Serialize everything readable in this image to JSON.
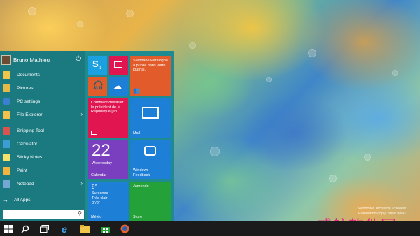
{
  "start_menu": {
    "user": {
      "name": "Bruno Mathieu"
    },
    "items": [
      {
        "label": "Documents",
        "icon": "folder-icon",
        "color": "#f0c64a"
      },
      {
        "label": "Pictures",
        "icon": "pictures-icon",
        "color": "#e7b949"
      },
      {
        "label": "PC settings",
        "icon": "gear-icon",
        "color": "#3b7fd0"
      },
      {
        "label": "File Explorer",
        "icon": "file-explorer-icon",
        "color": "#f3c24b",
        "submenu": true
      },
      {
        "label": "Snipping Tool",
        "icon": "scissors-icon",
        "color": "#d9534f"
      },
      {
        "label": "Calculator",
        "icon": "calculator-icon",
        "color": "#3c9cd5"
      },
      {
        "label": "Sticky Notes",
        "icon": "sticky-notes-icon",
        "color": "#f4e36b"
      },
      {
        "label": "Paint",
        "icon": "paint-icon",
        "color": "#f2b43c"
      },
      {
        "label": "Notepad",
        "icon": "notepad-icon",
        "color": "#73a8d4",
        "submenu": true
      }
    ],
    "all_apps": "All Apps",
    "search": {
      "placeholder": ""
    }
  },
  "tiles": {
    "skype": {
      "badge": "1",
      "color": "#1ba1e2"
    },
    "video": {
      "color": "#e1154f"
    },
    "people": {
      "text": "Stephane Paravigna a publié dans votre journal.",
      "color": "#e25c2b"
    },
    "music": {
      "color": "#e25c2b"
    },
    "onedrive": {
      "color": "#1e7fd6"
    },
    "news": {
      "text": "Comment destituer le président de la République [en…",
      "color": "#e1154f"
    },
    "mail": {
      "label": "Mail",
      "color": "#1e7fd6"
    },
    "calendar": {
      "day": "22",
      "weekday": "Wednesday",
      "label": "Calendar",
      "color": "#7a3fbf"
    },
    "feedback": {
      "label": "Windows Feedback",
      "color": "#1e7fd6"
    },
    "weather": {
      "temp": "8°",
      "city": "Suresnes",
      "condition": "Très clair",
      "range": "8°/3°",
      "label": "Météo",
      "color": "#1e7fd6"
    },
    "store": {
      "app": "Jamendo",
      "label": "Store",
      "color": "#25a13a"
    }
  },
  "taskbar": {
    "icons": [
      "windows-start-icon",
      "search-icon",
      "task-view-icon",
      "internet-explorer-icon",
      "file-explorer-icon",
      "store-icon",
      "firefox-icon"
    ]
  },
  "watermark": {
    "line1": "Windows Technical Preview",
    "line2": "Evaluation copy. Build 9860"
  },
  "cn_watermark": "威航软件园"
}
